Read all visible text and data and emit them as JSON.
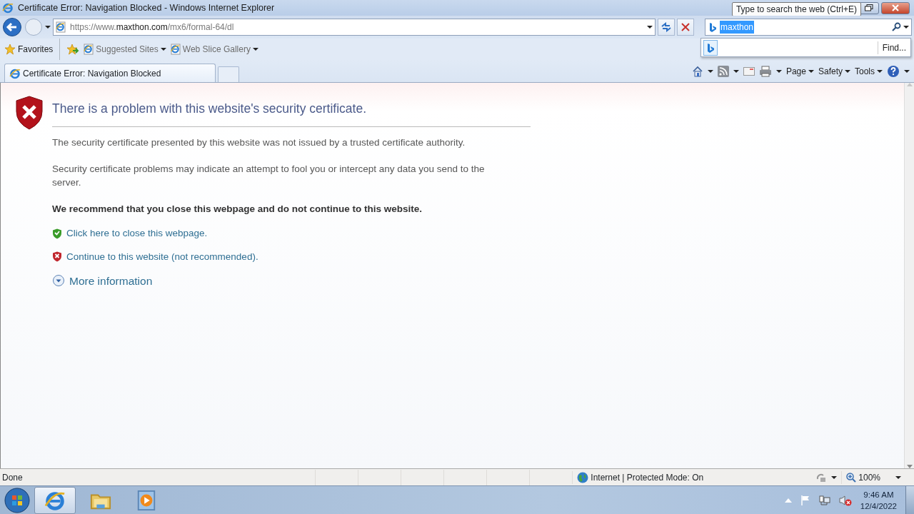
{
  "window": {
    "title": "Certificate Error: Navigation Blocked - Windows Internet Explorer",
    "tooltip": "Type to search the web (Ctrl+E)"
  },
  "address_bar": {
    "url": "https://www.**maxthon.com**/mx6/formal-64/dl"
  },
  "search": {
    "value": "maxthon",
    "text_selected": true,
    "find": "Find..."
  },
  "favorites_bar": {
    "label": "Favorites",
    "links": [
      {
        "label": "Suggested Sites"
      },
      {
        "label": "Web Slice Gallery"
      }
    ]
  },
  "tabs": [
    {
      "label": "Certificate Error: Navigation Blocked",
      "selected": true
    }
  ],
  "command_bar": [
    "Page",
    "Safety",
    "Tools"
  ],
  "page": {
    "heading": "There is a problem with this website's security certificate.",
    "paragraphs": [
      "The security certificate presented by this website was not issued by a trusted certificate authority.",
      "Security certificate problems may indicate an attempt to fool you or intercept any data you send to the server."
    ],
    "recommendation": "We recommend that you close this webpage and do not continue to this website.",
    "links": [
      {
        "kind": "safe",
        "label": "Click here to close this webpage."
      },
      {
        "kind": "unsafe",
        "label": "Continue to this website (not recommended)."
      }
    ],
    "more": "More information"
  },
  "status_bar": {
    "text": "Done",
    "zone": "Internet | Protected Mode: On",
    "zoom": "100%"
  },
  "taskbar": {
    "apps": [
      {
        "kind": "ie",
        "selected": true
      },
      {
        "kind": "explorer",
        "selected": false
      },
      {
        "kind": "media",
        "selected": false
      }
    ],
    "time": "9:46 AM",
    "date": "12/4/2022"
  }
}
